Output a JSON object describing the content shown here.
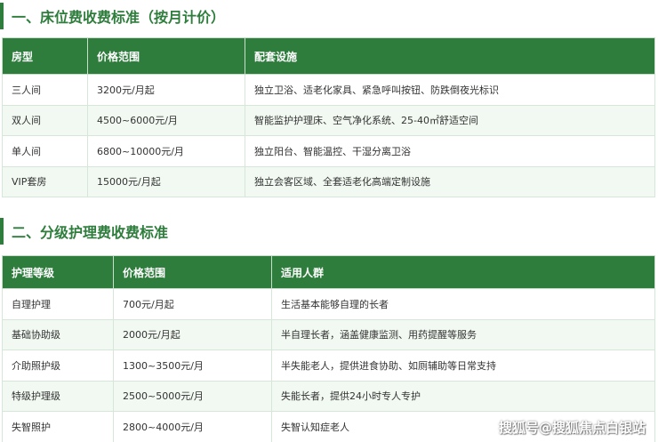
{
  "section1": {
    "title": "一、床位费收费标准（按月计价）",
    "headers": [
      "房型",
      "价格范围",
      "配套设施"
    ],
    "rows": [
      [
        "三人间",
        "3200元/月起",
        "独立卫浴、适老化家具、紧急呼叫按钮、防跌倒夜光标识"
      ],
      [
        "双人间",
        "4500~6000元/月",
        "智能监护护理床、空气净化系统、25-40㎡舒适空间"
      ],
      [
        "单人间",
        "6800~10000元/月",
        "独立阳台、智能温控、干湿分离卫浴"
      ],
      [
        "VIP套房",
        "15000元/月起",
        "独立会客区域、全套适老化高端定制设施"
      ]
    ]
  },
  "section2": {
    "title": "二、分级护理费收费标准",
    "headers": [
      "护理等级",
      "价格范围",
      "适用人群"
    ],
    "rows": [
      [
        "自理护理",
        "700元/月起",
        "生活基本能够自理的长者"
      ],
      [
        "基础协助级",
        "2000元/月起",
        "半自理长者，涵盖健康监测、用药提醒等服务"
      ],
      [
        "介助照护级",
        "1300~3500元/月",
        "半失能老人，提供进食协助、如厕辅助等日常支持"
      ],
      [
        "特级护理级",
        "2500~5000元/月",
        "失能长者，提供24小时专人专护"
      ],
      [
        "失智照护",
        "2800~4000元/月",
        "失智认知症老人"
      ]
    ]
  },
  "watermark": "搜狐号@搜狐焦点白银站",
  "colors": {
    "accent": "#2e7d3c",
    "row_alt": "#f2f9f2",
    "border": "#d6e6d8"
  }
}
